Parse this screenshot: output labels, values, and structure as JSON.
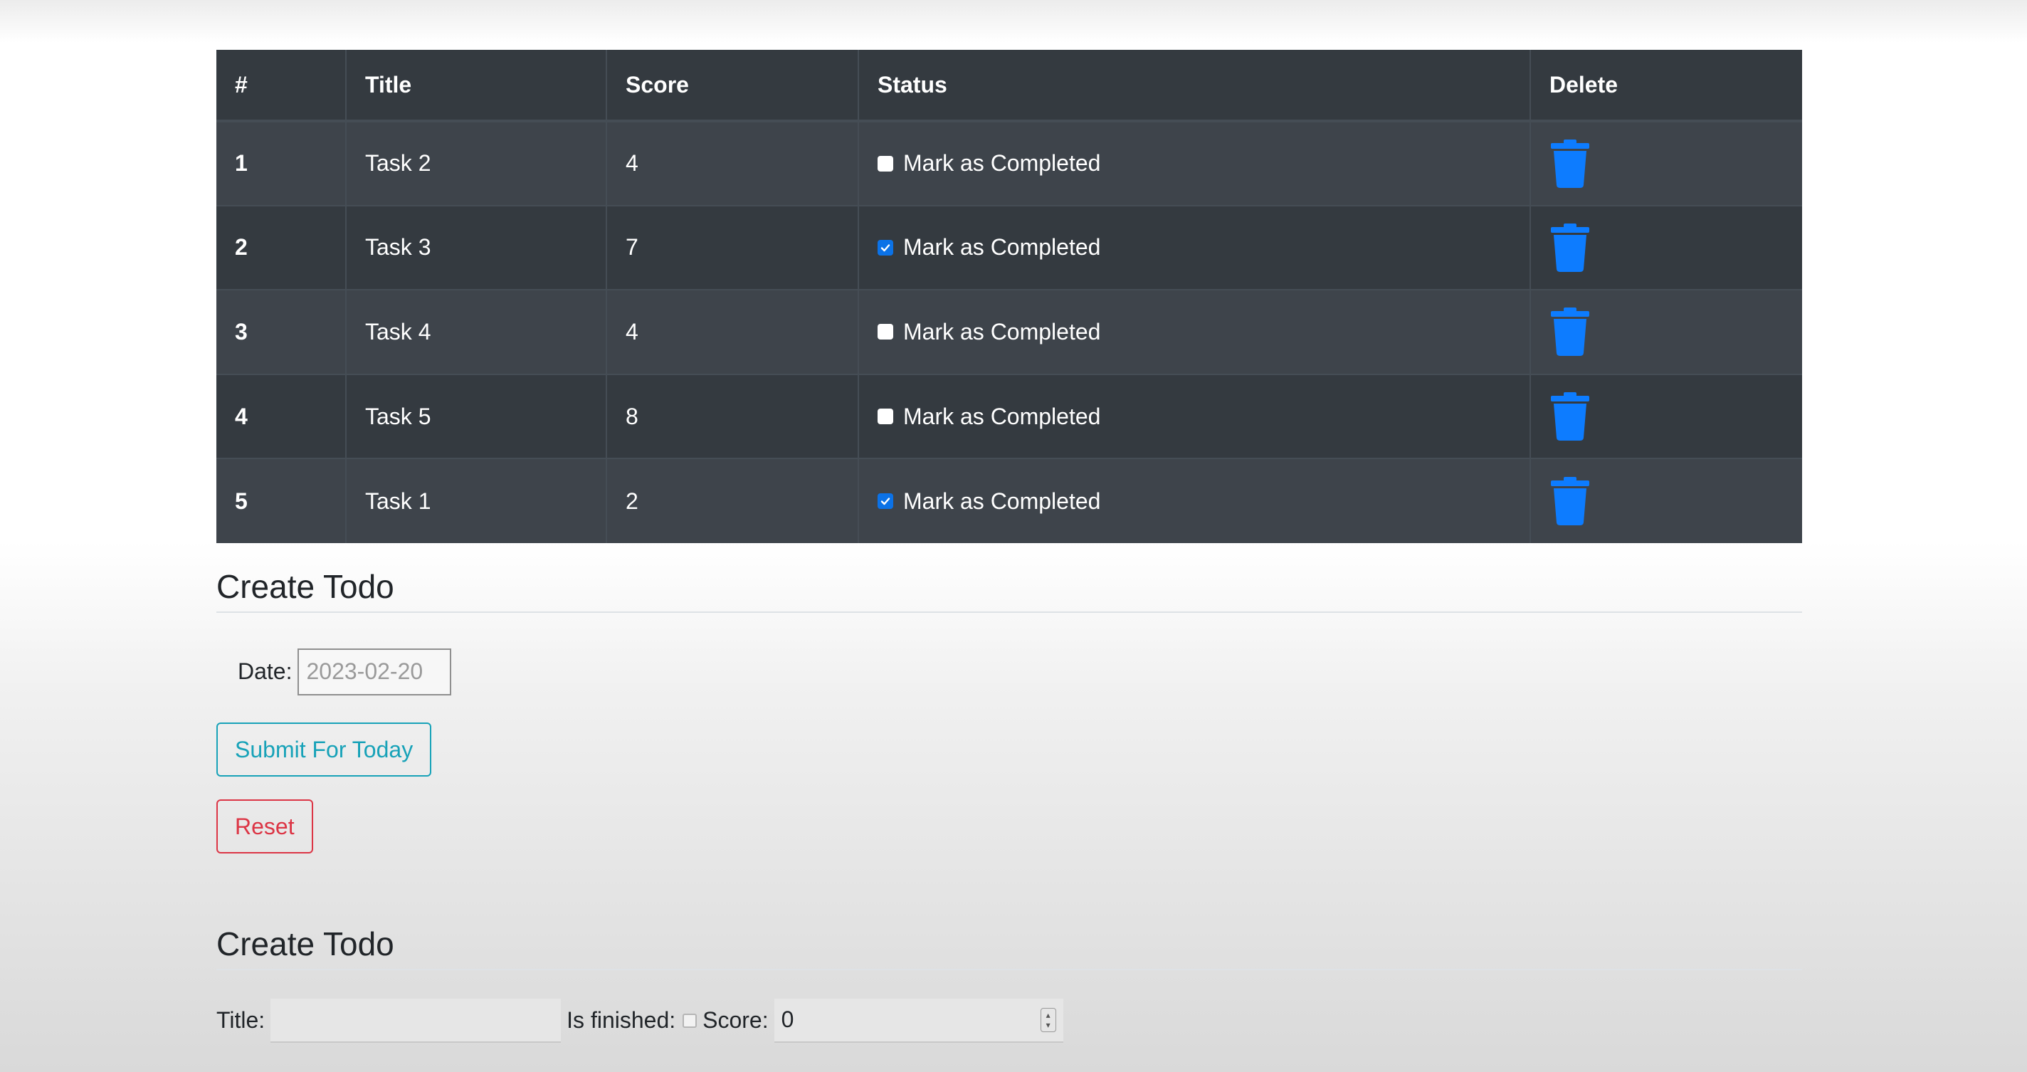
{
  "table": {
    "headers": [
      "#",
      "Title",
      "Score",
      "Status",
      "Delete"
    ],
    "rows": [
      {
        "num": "1",
        "title": "Task 2",
        "score": "4",
        "status_label": "Mark as Completed",
        "checked": false
      },
      {
        "num": "2",
        "title": "Task 3",
        "score": "7",
        "status_label": "Mark as Completed",
        "checked": true
      },
      {
        "num": "3",
        "title": "Task 4",
        "score": "4",
        "status_label": "Mark as Completed",
        "checked": false
      },
      {
        "num": "4",
        "title": "Task 5",
        "score": "8",
        "status_label": "Mark as Completed",
        "checked": false
      },
      {
        "num": "5",
        "title": "Task 1",
        "score": "2",
        "status_label": "Mark as Completed",
        "checked": true
      }
    ]
  },
  "create_today": {
    "heading": "Create Todo",
    "date_label": "Date:",
    "date_value": "2023-02-20",
    "submit_label": "Submit For Today",
    "reset_label": "Reset"
  },
  "create_todo": {
    "heading": "Create Todo",
    "title_label": "Title:",
    "title_value": "",
    "finished_label": "Is finished:",
    "score_label": "Score:",
    "score_value": "0"
  },
  "colors": {
    "table_bg": "#343a40",
    "checkbox_checked": "#0b72e7",
    "trash_icon": "#0d7cff",
    "info": "#17a2b8",
    "danger": "#dc3545"
  }
}
